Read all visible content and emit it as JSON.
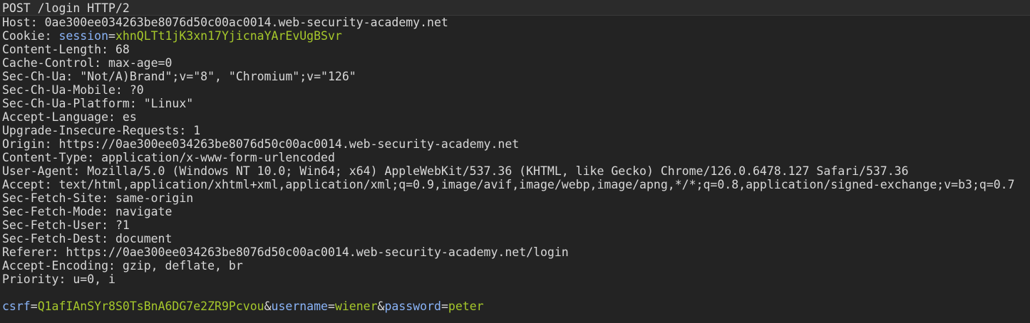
{
  "colors": {
    "background": "#232323",
    "text": "#dcdcdc",
    "param_name": "#8ab4f8",
    "param_value": "#a6c82b"
  },
  "request_line": "POST /login HTTP/2",
  "headers": [
    {
      "name": "Host",
      "value": "0ae300ee034263be8076d50c00ac0014.web-security-academy.net"
    },
    {
      "name": "Cookie",
      "value": ""
    },
    {
      "name": "Content-Length",
      "value": "68"
    },
    {
      "name": "Cache-Control",
      "value": "max-age=0"
    },
    {
      "name": "Sec-Ch-Ua",
      "value": "\"Not/A)Brand\";v=\"8\", \"Chromium\";v=\"126\""
    },
    {
      "name": "Sec-Ch-Ua-Mobile",
      "value": "?0"
    },
    {
      "name": "Sec-Ch-Ua-Platform",
      "value": "\"Linux\""
    },
    {
      "name": "Accept-Language",
      "value": "es"
    },
    {
      "name": "Upgrade-Insecure-Requests",
      "value": "1"
    },
    {
      "name": "Origin",
      "value": "https://0ae300ee034263be8076d50c00ac0014.web-security-academy.net"
    },
    {
      "name": "Content-Type",
      "value": "application/x-www-form-urlencoded"
    },
    {
      "name": "User-Agent",
      "value": "Mozilla/5.0 (Windows NT 10.0; Win64; x64) AppleWebKit/537.36 (KHTML, like Gecko) Chrome/126.0.6478.127 Safari/537.36"
    },
    {
      "name": "Accept",
      "value": "text/html,application/xhtml+xml,application/xml;q=0.9,image/avif,image/webp,image/apng,*/*;q=0.8,application/signed-exchange;v=b3;q=0.7"
    },
    {
      "name": "Sec-Fetch-Site",
      "value": "same-origin"
    },
    {
      "name": "Sec-Fetch-Mode",
      "value": "navigate"
    },
    {
      "name": "Sec-Fetch-User",
      "value": "?1"
    },
    {
      "name": "Sec-Fetch-Dest",
      "value": "document"
    },
    {
      "name": "Referer",
      "value": "https://0ae300ee034263be8076d50c00ac0014.web-security-academy.net/login"
    },
    {
      "name": "Accept-Encoding",
      "value": "gzip, deflate, br"
    },
    {
      "name": "Priority",
      "value": "u=0, i"
    }
  ],
  "cookie": {
    "name": "session",
    "value": "xhnQLTt1jK3xn17YjicnaYArEvUgBSvr"
  },
  "body_params": [
    {
      "name": "csrf",
      "value": "Q1afIAnSYr8S0TsBnA6DG7e2ZR9Pcvou"
    },
    {
      "name": "username",
      "value": "wiener"
    },
    {
      "name": "password",
      "value": "peter"
    }
  ],
  "punct": {
    "colon": ": ",
    "equals": "=",
    "amp": "&"
  }
}
